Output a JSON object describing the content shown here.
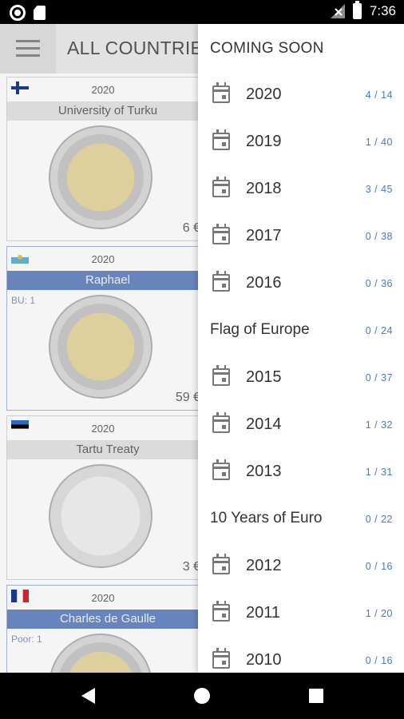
{
  "status_bar": {
    "time": "7:36",
    "icons": [
      "record-icon",
      "sd-card-icon",
      "no-signal-icon",
      "battery-icon"
    ]
  },
  "app_bar": {
    "title": "ALL COUNTRIES",
    "menu_icon": "hamburger-icon"
  },
  "cards": [
    {
      "flag": "finland-flag-icon",
      "year": "2020",
      "name": "University of Turku",
      "tag": "",
      "price": "6 €",
      "selected": false
    },
    {
      "flag": "san-marino-flag-icon",
      "year": "2020",
      "name": "Raphael",
      "tag": "BU: 1",
      "price": "59 €",
      "selected": true
    },
    {
      "flag": "estonia-flag-icon",
      "year": "2020",
      "name": "Tartu Treaty",
      "tag": "",
      "price": "3 €",
      "selected": false
    },
    {
      "flag": "france-flag-icon",
      "year": "2020",
      "name": "Charles de Gaulle",
      "tag": "Poor: 1",
      "price": "",
      "selected": true
    }
  ],
  "drawer": {
    "header": "COMING SOON",
    "items": [
      {
        "type": "year",
        "label": "2020",
        "count": "4 / 14"
      },
      {
        "type": "year",
        "label": "2019",
        "count": "1 / 40"
      },
      {
        "type": "year",
        "label": "2018",
        "count": "3 / 45"
      },
      {
        "type": "year",
        "label": "2017",
        "count": "0 / 38"
      },
      {
        "type": "year",
        "label": "2016",
        "count": "0 / 36"
      },
      {
        "type": "section",
        "label": "Flag of Europe",
        "count": "0 / 24"
      },
      {
        "type": "year",
        "label": "2015",
        "count": "0 / 37"
      },
      {
        "type": "year",
        "label": "2014",
        "count": "1 / 32"
      },
      {
        "type": "year",
        "label": "2013",
        "count": "1 / 31"
      },
      {
        "type": "section",
        "label": "10 Years of Euro",
        "count": "0 / 22"
      },
      {
        "type": "year",
        "label": "2012",
        "count": "0 / 16"
      },
      {
        "type": "year",
        "label": "2011",
        "count": "1 / 20"
      },
      {
        "type": "year",
        "label": "2010",
        "count": "0 / 16"
      }
    ]
  },
  "colors": {
    "accent": "#4a78c2",
    "selected_bar": "#6c8bc4"
  },
  "nav_bar": {
    "icons": [
      "back-icon",
      "home-icon",
      "recents-icon"
    ]
  }
}
